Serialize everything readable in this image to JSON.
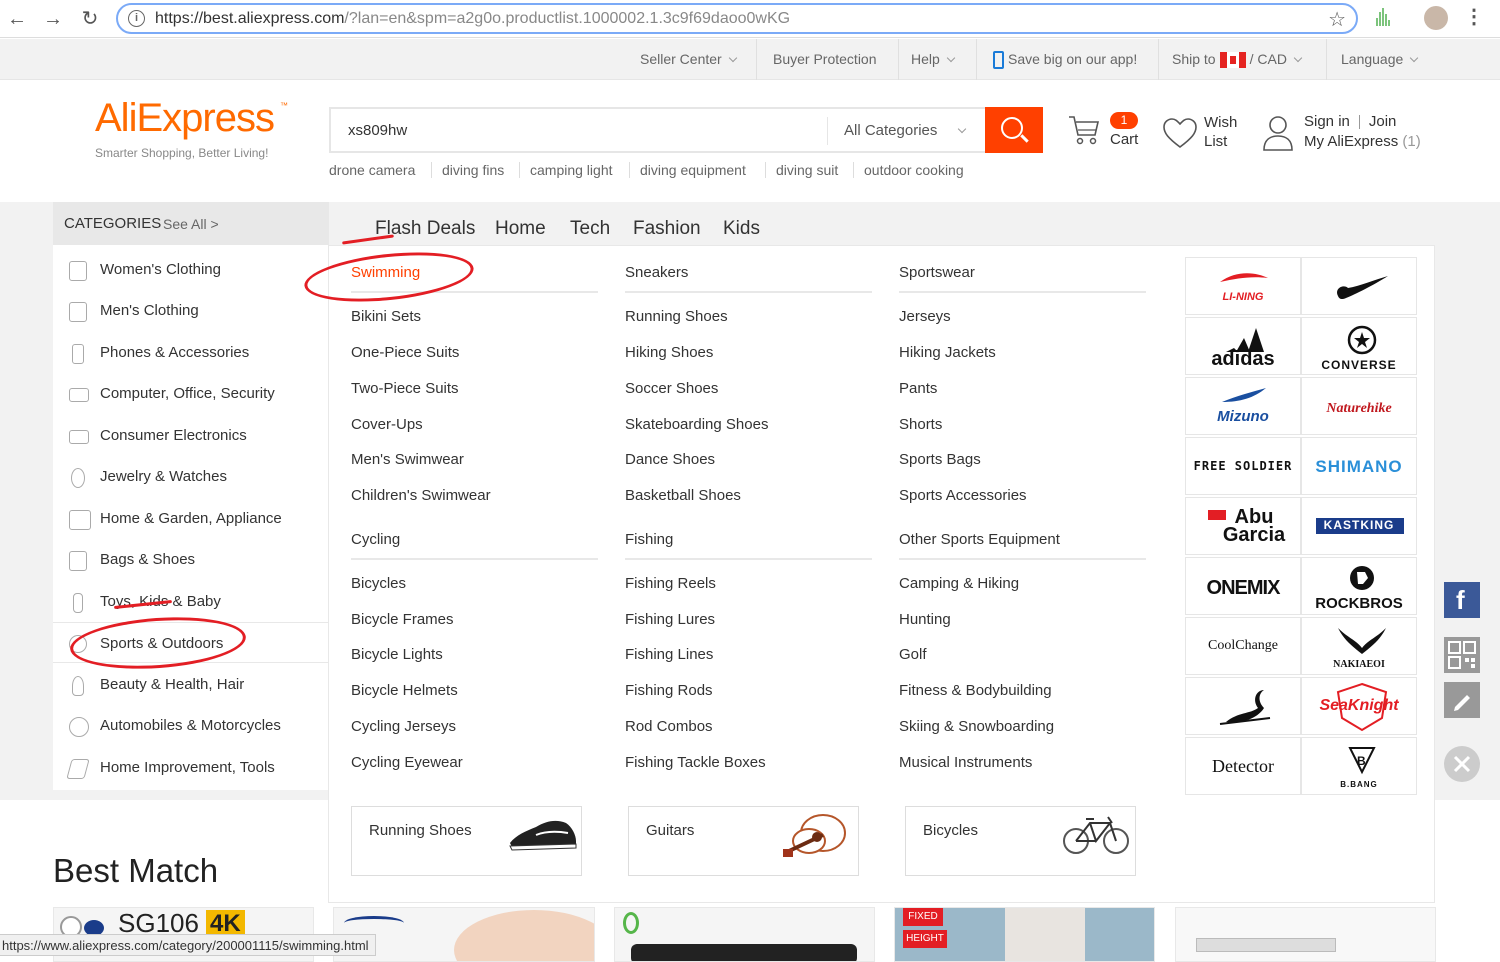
{
  "browser": {
    "url_host": "https://best.aliexpress.com",
    "url_path": "/?lan=en&spm=a2g0o.productlist.1000002.1.3c9f69daoo0wKG"
  },
  "topbar": {
    "seller_center": "Seller Center",
    "buyer_protection": "Buyer Protection",
    "help": "Help",
    "app": "Save big on our app!",
    "ship_to": "Ship to",
    "currency_sep": "/",
    "currency": "CAD",
    "language": "Language"
  },
  "header": {
    "logo": "AliExpress",
    "tagline": "Smarter Shopping, Better Living!",
    "search_value": "xs809hw",
    "category_select": "All Categories",
    "hot_keywords": [
      "drone camera",
      "diving fins",
      "camping light",
      "diving equipment",
      "diving suit",
      "outdoor cooking"
    ],
    "cart_count": "1",
    "cart_label": "Cart",
    "wish_line1": "Wish",
    "wish_line2": "List",
    "sign_in": "Sign in",
    "join": "Join",
    "my_aliexpress": "My AliExpress",
    "my_count": "(1)"
  },
  "categories": {
    "title": "CATEGORIES",
    "see_all": "See All >",
    "items": [
      "Women's Clothing",
      "Men's Clothing",
      "Phones & Accessories",
      "Computer, Office, Security",
      "Consumer Electronics",
      "Jewelry & Watches",
      "Home & Garden, Appliance",
      "Bags & Shoes",
      "Toys, Kids & Baby",
      "Sports & Outdoors",
      "Beauty & Health, Hair",
      "Automobiles & Motorcycles",
      "Home Improvement, Tools"
    ]
  },
  "tabs": [
    "Flash Deals",
    "Home",
    "Tech",
    "Fashion",
    "Kids"
  ],
  "mega": {
    "col1": {
      "head1": "Swimming",
      "items1": [
        "Bikini Sets",
        "One-Piece Suits",
        "Two-Piece Suits",
        "Cover-Ups",
        "Men's Swimwear",
        "Children's Swimwear"
      ],
      "head2": "Cycling",
      "items2": [
        "Bicycles",
        "Bicycle Frames",
        "Bicycle Lights",
        "Bicycle Helmets",
        "Cycling Jerseys",
        "Cycling Eyewear"
      ]
    },
    "col2": {
      "head1": "Sneakers",
      "items1": [
        "Running Shoes",
        "Hiking Shoes",
        "Soccer Shoes",
        "Skateboarding Shoes",
        "Dance Shoes",
        "Basketball Shoes"
      ],
      "head2": "Fishing",
      "items2": [
        "Fishing Reels",
        "Fishing Lures",
        "Fishing Lines",
        "Fishing Rods",
        "Rod Combos",
        "Fishing Tackle Boxes"
      ]
    },
    "col3": {
      "head1": "Sportswear",
      "items1": [
        "Jerseys",
        "Hiking Jackets",
        "Pants",
        "Shorts",
        "Sports Bags",
        "Sports Accessories"
      ],
      "head2": "Other Sports Equipment",
      "items2": [
        "Camping & Hiking",
        "Hunting",
        "Golf",
        "Fitness & Bodybuilding",
        "Skiing & Snowboarding",
        "Musical Instruments"
      ]
    },
    "brands": [
      "LI-NING",
      "Nike",
      "adidas",
      "CONVERSE",
      "Mizuno",
      "Naturehike",
      "FREE SOLDIER",
      "SHIMANO",
      "Abu Garcia",
      "KASTKING",
      "ONEMIX",
      "ROCKBROS",
      "CoolChange",
      "NAKIAEOI",
      "Swoosh",
      "SeaKnight",
      "Detector",
      "B.BANG"
    ],
    "promos": [
      "Running Shoes",
      "Guitars",
      "Bicycles"
    ]
  },
  "best_match": "Best Match",
  "product_badges": {
    "sg": "SG106",
    "k4": "4K",
    "fixed1": "FIXED",
    "fixed2": "HEIGHT"
  },
  "status_bar_url": "https://www.aliexpress.com/category/200001115/swimming.html",
  "colors": {
    "accent": "#ff4000",
    "logo": "#ff6a00",
    "annotation": "#e31e24"
  }
}
